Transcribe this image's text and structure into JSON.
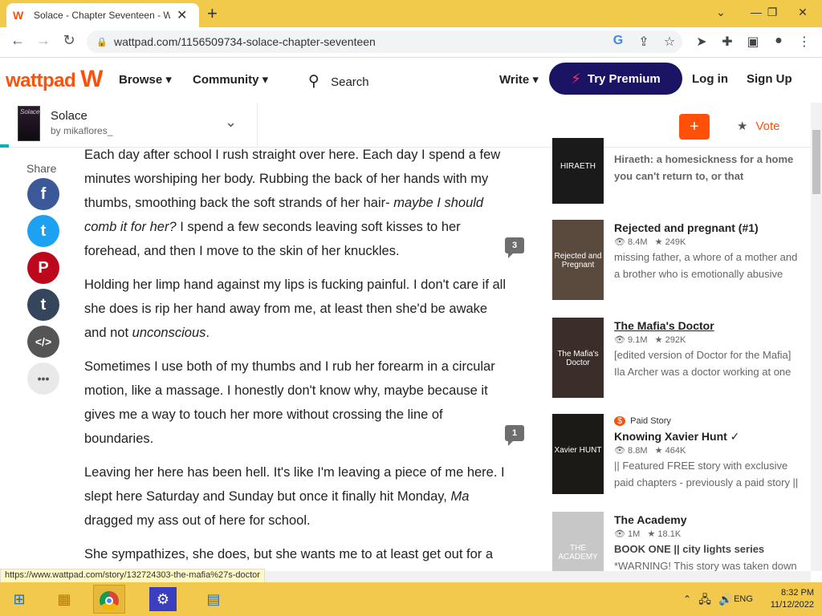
{
  "browser": {
    "tab_title": "Solace - Chapter Seventeen - Wa",
    "url": "wattpad.com/1156509734-solace-chapter-seventeen",
    "status_url": "https://www.wattpad.com/story/132724303-the-mafia%27s-doctor"
  },
  "header": {
    "logo": "wattpad",
    "browse": "Browse",
    "community": "Community",
    "search": "Search",
    "write": "Write",
    "premium": "Try Premium",
    "login": "Log in",
    "signup": "Sign Up"
  },
  "story": {
    "title": "Solace",
    "author": "by mikaflores_",
    "cover_text": "Solace",
    "add_label": "+",
    "vote_label": "Vote"
  },
  "share": {
    "label": "Share",
    "buttons": [
      {
        "name": "facebook",
        "glyph": "f",
        "color": "#3b5998"
      },
      {
        "name": "twitter",
        "glyph": "t",
        "color": "#1da1f2"
      },
      {
        "name": "pinterest",
        "glyph": "P",
        "color": "#bd081c"
      },
      {
        "name": "tumblr",
        "glyph": "t",
        "color": "#35465c"
      },
      {
        "name": "embed",
        "glyph": "</>",
        "color": "#555555"
      },
      {
        "name": "more",
        "glyph": "•••",
        "color": "#e9e9e9"
      }
    ]
  },
  "chapter": {
    "p0": "Each day after school I rush straight over here. Each day I spend a few minutes worshiping her body. Rubbing the back of her hands with my thumbs, smoothing back the soft strands of her hair- ",
    "p0_em": "maybe I should comb it for her?",
    "p0_end": " I spend a few seconds leaving soft kisses to her forehead, and then I move to the skin of her knuckles.",
    "p1": "Holding her limp hand against my lips is fucking painful. I don't care if all she does is rip her hand away from me, at least then she'd be awake and not ",
    "p1_em": "unconscious",
    "p1_end": ".",
    "p2": "Sometimes I use both of my thumbs and I rub her forearm in a circular motion, like a massage. I honestly don't know why, maybe because it gives me a way to touch her more without crossing the line of boundaries.",
    "p3": "Leaving her here has been hell. It's like I'm leaving a piece of me here. I slept here Saturday and Sunday but once it finally hit Monday, ",
    "p3_em": "Ma",
    "p3_end": " dragged my ass out of here for school.",
    "p4": "She sympathizes, she does, but she wants me to at least get out for a",
    "comments": [
      "3",
      "1"
    ]
  },
  "recommendations": [
    {
      "title": "",
      "reads": "",
      "votes": "",
      "desc": "Hiraeth: a homesickness for a home you can't return to, or that",
      "thumb": "HIRAETH"
    },
    {
      "title": "Rejected and pregnant (#1)",
      "reads": "8.4M",
      "votes": "249K",
      "desc": "missing father, a whore of a mother and a brother who is emotionally abusive",
      "thumb": "Rejected and Pregnant"
    },
    {
      "title": "The Mafia's Doctor",
      "reads": "9.1M",
      "votes": "292K",
      "desc": "[edited version of Doctor for the Mafia] Ila Archer was a doctor working at one",
      "thumb": "The Mafia's Doctor"
    },
    {
      "title": "Knowing Xavier Hunt ✓",
      "reads": "8.8M",
      "votes": "464K",
      "desc": "|| Featured FREE story with exclusive paid chapters - previously a paid story ||",
      "thumb": "Xavier HUNT",
      "badge": "Paid Story"
    },
    {
      "title": "The Academy",
      "reads": "1M",
      "votes": "18.1K",
      "desc": "BOOK ONE || city lights series",
      "desc2": "*WARNING! This story was taken down",
      "thumb": "THE ACADEMY"
    }
  ],
  "taskbar": {
    "lang": "ENG",
    "time": "8:32 PM",
    "date": "11/12/2022"
  },
  "colors": {
    "brand": "#ff500a",
    "premium": "#1b1464",
    "taskbar": "#f2c94c"
  }
}
